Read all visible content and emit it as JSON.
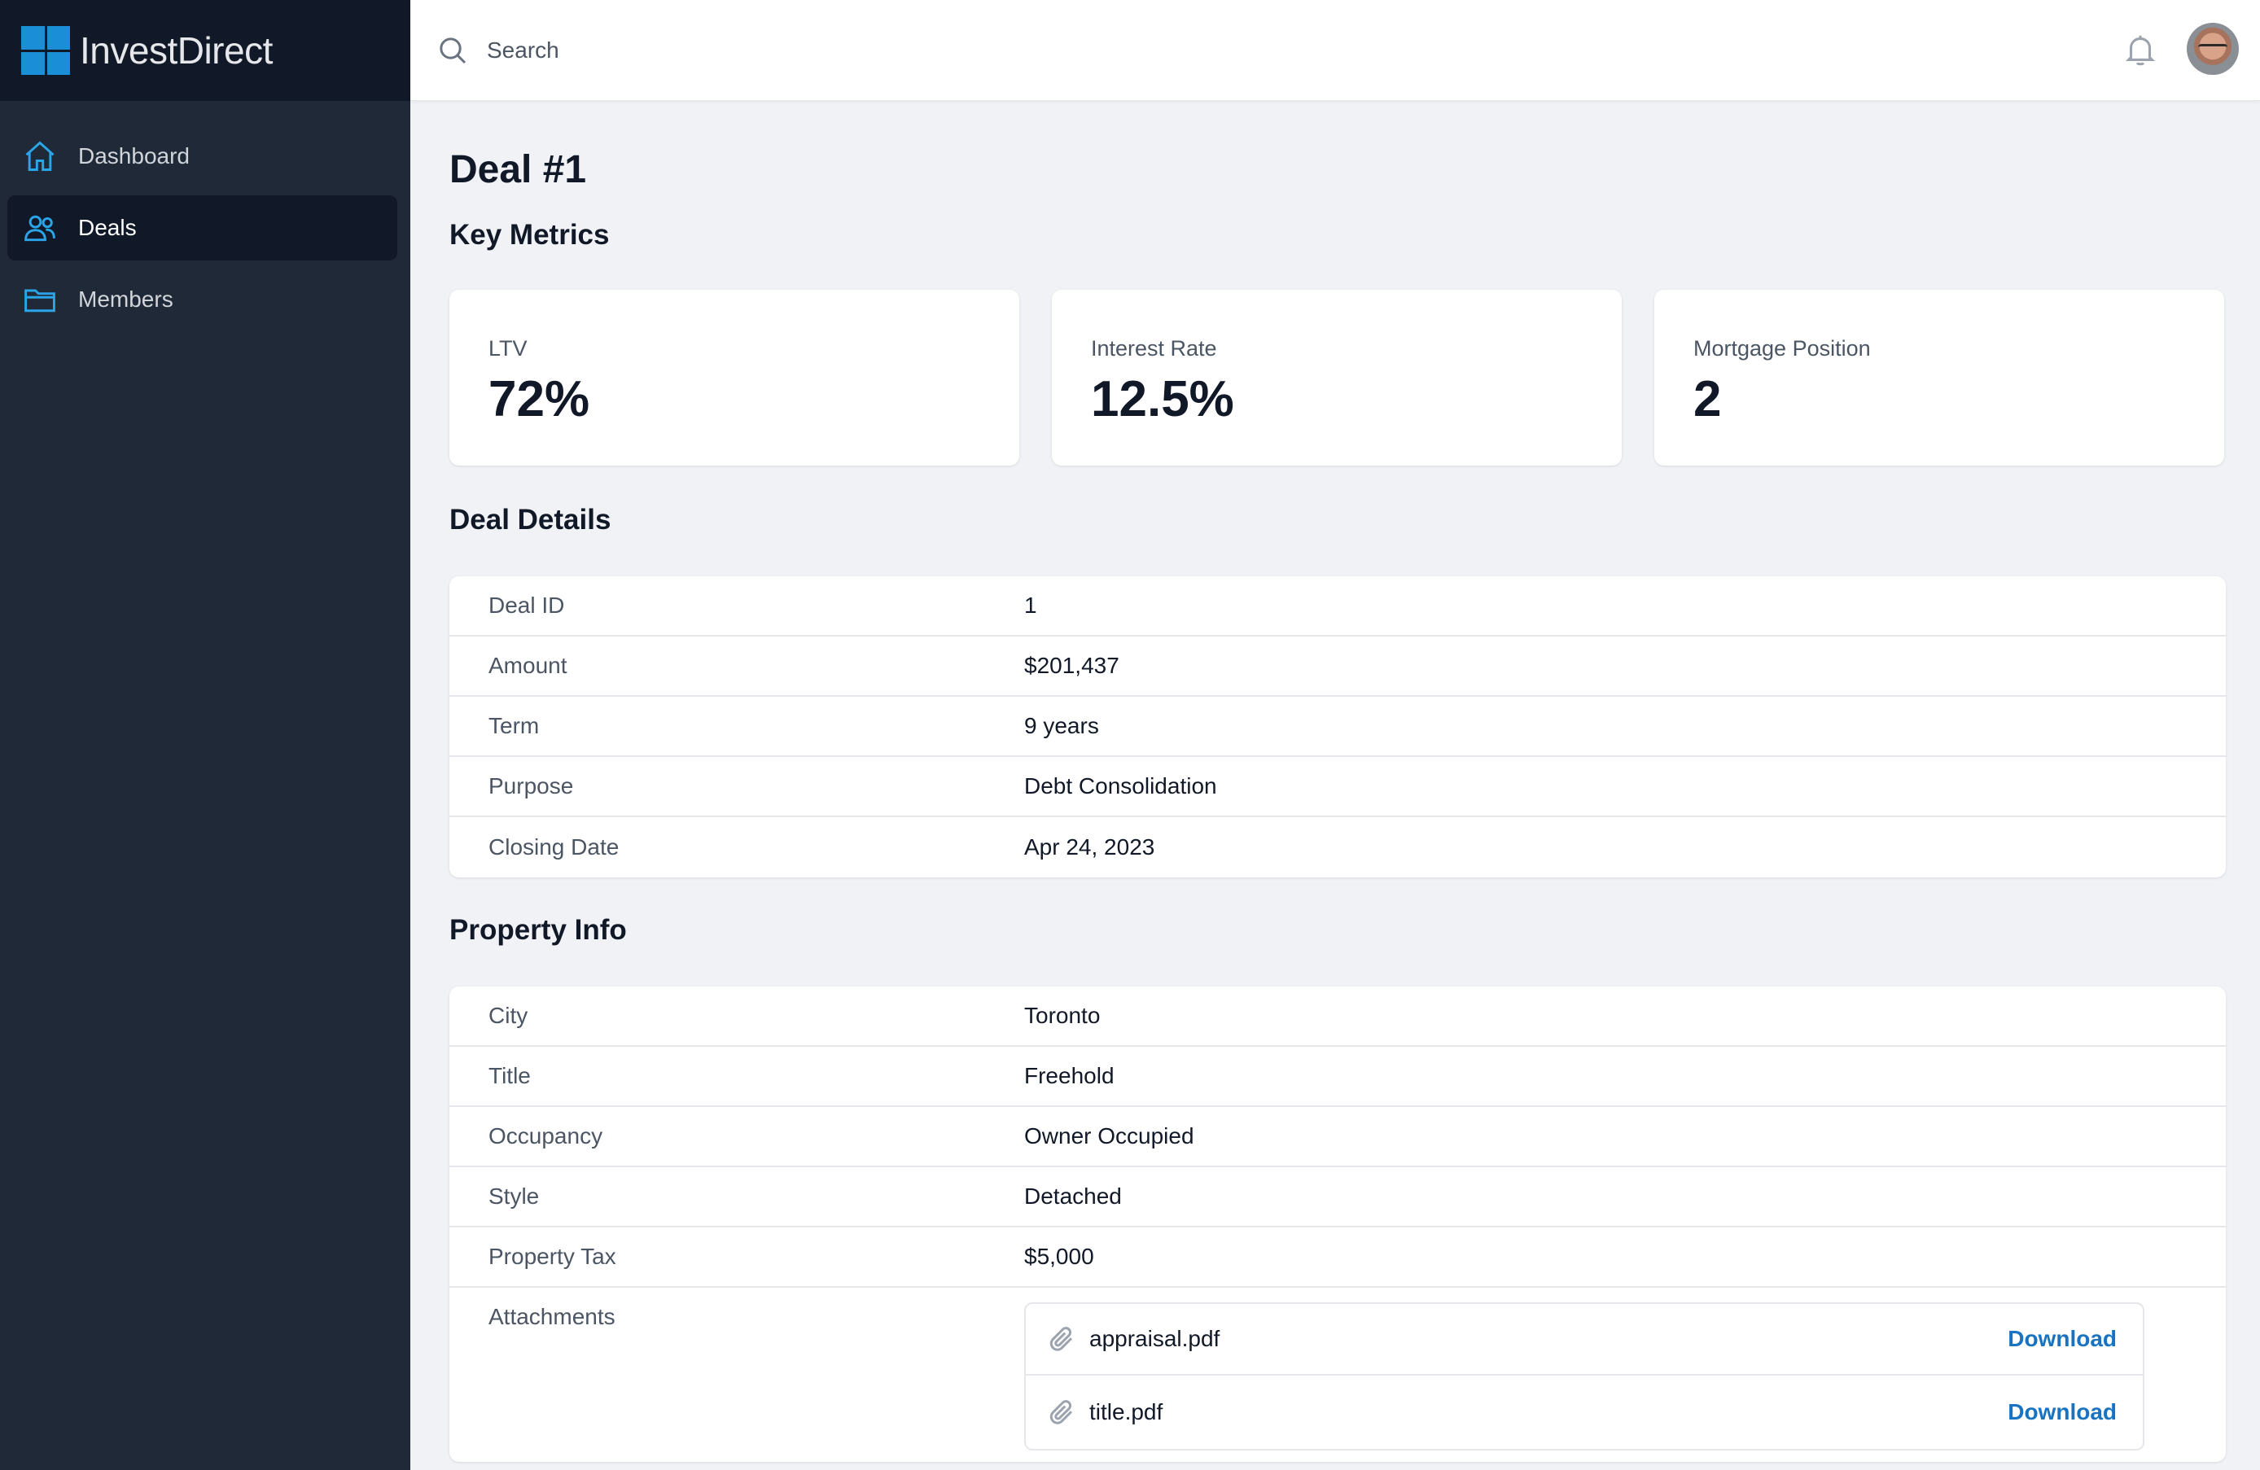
{
  "brand": {
    "name": "InvestDirect",
    "logo_color": "#1a8fd8"
  },
  "sidebar": {
    "items": [
      {
        "label": "Dashboard",
        "icon": "home-icon",
        "active": false
      },
      {
        "label": "Deals",
        "icon": "users-icon",
        "active": true
      },
      {
        "label": "Members",
        "icon": "folder-icon",
        "active": false
      }
    ]
  },
  "topbar": {
    "search_placeholder": "Search"
  },
  "page": {
    "title": "Deal #1"
  },
  "key_metrics": {
    "title": "Key Metrics",
    "cards": [
      {
        "label": "LTV",
        "value": "72%"
      },
      {
        "label": "Interest Rate",
        "value": "12.5%"
      },
      {
        "label": "Mortgage Position",
        "value": "2"
      }
    ]
  },
  "deal_details": {
    "title": "Deal Details",
    "rows": [
      {
        "label": "Deal ID",
        "value": "1"
      },
      {
        "label": "Amount",
        "value": "$201,437"
      },
      {
        "label": "Term",
        "value": "9 years"
      },
      {
        "label": "Purpose",
        "value": "Debt Consolidation"
      },
      {
        "label": "Closing Date",
        "value": "Apr 24, 2023"
      }
    ]
  },
  "property_info": {
    "title": "Property Info",
    "rows": [
      {
        "label": "City",
        "value": "Toronto"
      },
      {
        "label": "Title",
        "value": "Freehold"
      },
      {
        "label": "Occupancy",
        "value": "Owner Occupied"
      },
      {
        "label": "Style",
        "value": "Detached"
      },
      {
        "label": "Property Tax",
        "value": "$5,000"
      }
    ],
    "attachments_label": "Attachments",
    "attachments": [
      {
        "name": "appraisal.pdf",
        "action": "Download"
      },
      {
        "name": "title.pdf",
        "action": "Download"
      }
    ]
  },
  "colors": {
    "accent": "#2aa5e8",
    "link": "#1a73c0",
    "sidebar_bg": "#1f2937",
    "sidebar_active_bg": "#111827"
  }
}
